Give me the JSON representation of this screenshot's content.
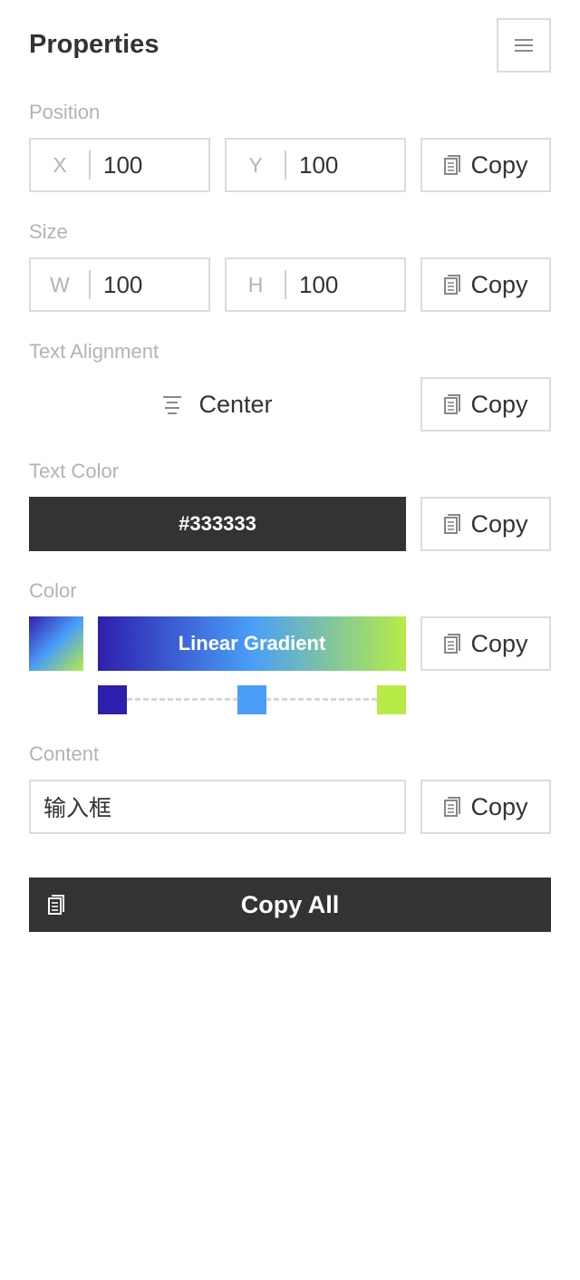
{
  "header": {
    "title": "Properties",
    "menu_icon": "hamburger-icon"
  },
  "position": {
    "label": "Position",
    "x_prefix": "X",
    "x_value": "100",
    "y_prefix": "Y",
    "y_value": "100",
    "copy_label": "Copy"
  },
  "size": {
    "label": "Size",
    "w_prefix": "W",
    "w_value": "100",
    "h_prefix": "H",
    "h_value": "100",
    "copy_label": "Copy"
  },
  "alignment": {
    "label": "Text Alignment",
    "value": "Center",
    "icon": "align-center-icon",
    "copy_label": "Copy"
  },
  "text_color": {
    "label": "Text Color",
    "value": "#333333",
    "copy_label": "Copy"
  },
  "color": {
    "label": "Color",
    "value": "Linear Gradient",
    "stops": [
      "#2d1fad",
      "#4a9ef8",
      "#b6ec45"
    ],
    "copy_label": "Copy"
  },
  "content": {
    "label": "Content",
    "value": "输入框",
    "copy_label": "Copy"
  },
  "footer": {
    "copy_all_label": "Copy All"
  },
  "colors": {
    "text": "#333333",
    "muted": "#b3b3b3",
    "border": "#dcdcdc",
    "dark": "#333333"
  }
}
